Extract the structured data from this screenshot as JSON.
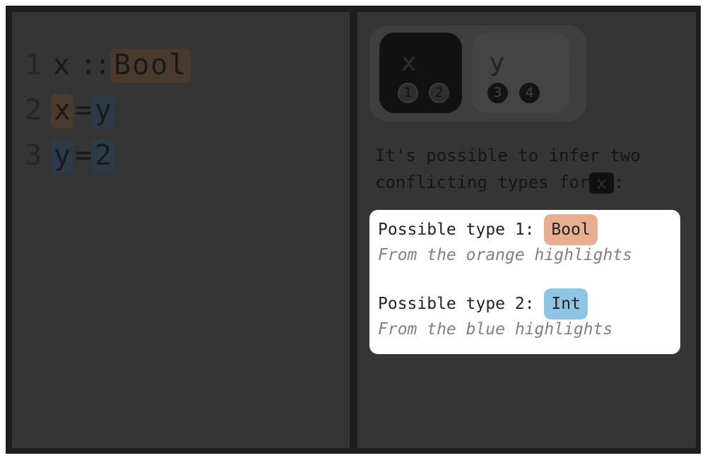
{
  "editor": {
    "lines": [
      {
        "number": "1",
        "tokens": [
          "x",
          "::",
          "Bool"
        ]
      },
      {
        "number": "2",
        "tokens": [
          "x",
          "=",
          "y"
        ]
      },
      {
        "number": "3",
        "tokens": [
          "y",
          "=",
          "2"
        ]
      }
    ]
  },
  "variables": [
    {
      "name": "x",
      "badges": [
        "1",
        "2"
      ]
    },
    {
      "name": "y",
      "badges": [
        "3",
        "4"
      ]
    }
  ],
  "explanation": {
    "text_before": "It's possible to infer two conflicting types for",
    "variable": "x",
    "text_after": ":"
  },
  "possible_types": [
    {
      "label": "Possible type 1:",
      "type": "Bool",
      "source": "From the orange highlights",
      "color": "#e9ae8f"
    },
    {
      "label": "Possible type 2:",
      "type": "Int",
      "source": "From the blue highlights",
      "color": "#8ec5e3"
    }
  ]
}
